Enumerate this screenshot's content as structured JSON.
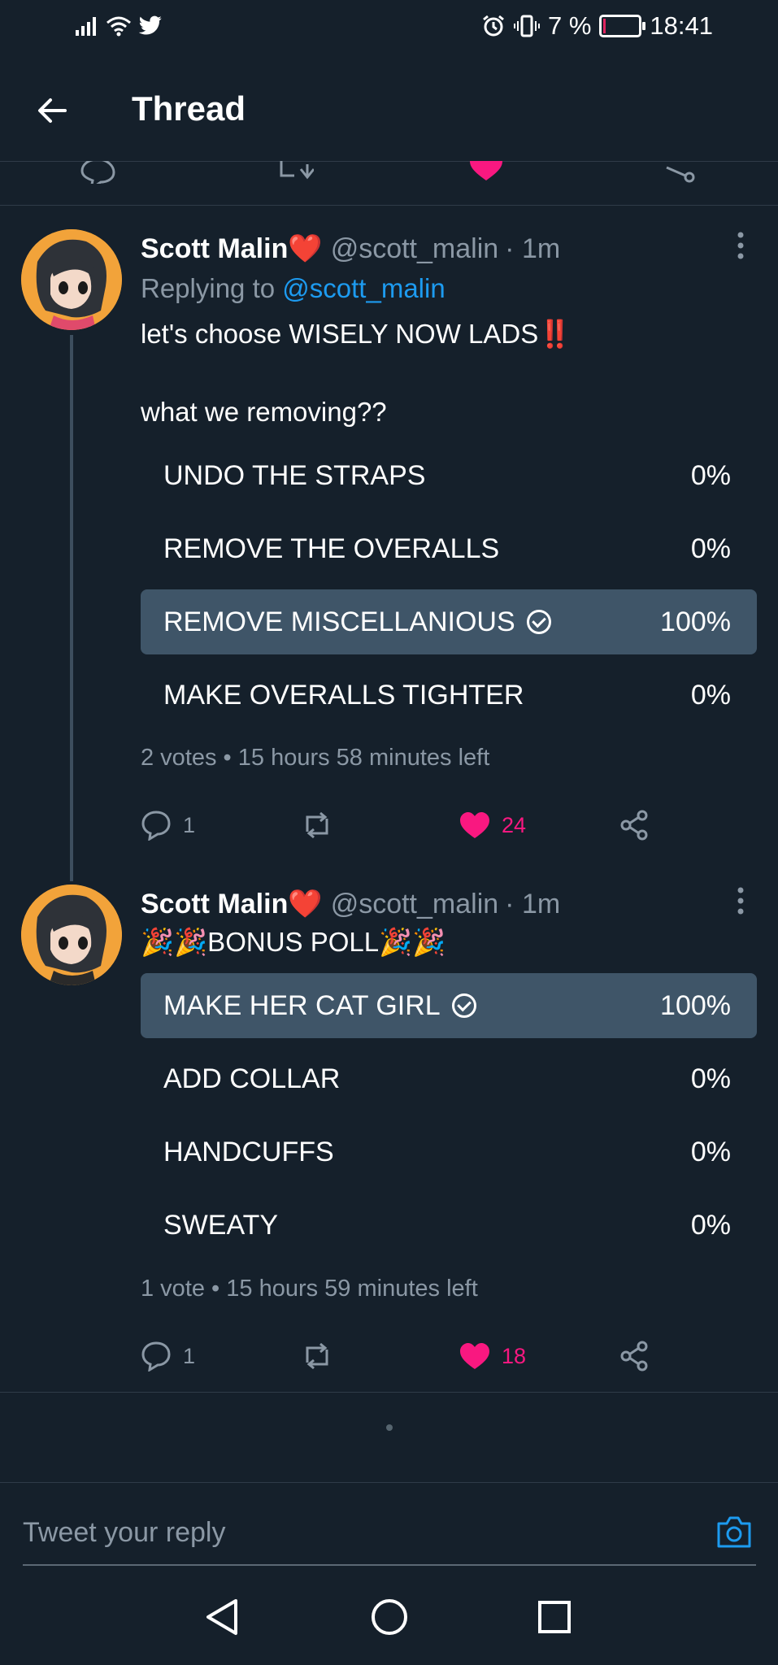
{
  "status_bar": {
    "left_icons": [
      "signal-icon",
      "wifi-icon",
      "twitter-bird-icon"
    ],
    "battery_level": "7 %",
    "battery_fraction": 0.07,
    "time": "18:41"
  },
  "header": {
    "title": "Thread"
  },
  "tweets": [
    {
      "name": "Scott Malin",
      "name_emoji": "❤️",
      "handle": "@scott_malin",
      "time": "· 1m",
      "replying_prefix": "Replying to",
      "replying_handle": "@scott_malin",
      "text_line1": "let's choose WISELY NOW LADS",
      "text_line1_emoji": "‼️",
      "text_line2": "what we removing??",
      "poll": [
        {
          "label": "UNDO THE STRAPS",
          "percent": "0%",
          "selected": false
        },
        {
          "label": "REMOVE THE OVERALLS",
          "percent": "0%",
          "selected": false
        },
        {
          "label": "REMOVE MISCELLANIOUS",
          "percent": "100%",
          "selected": true
        },
        {
          "label": "MAKE OVERALLS TIGHTER",
          "percent": "0%",
          "selected": false
        }
      ],
      "poll_meta": "2 votes • 15 hours 58 minutes left",
      "replies": "1",
      "likes": "24"
    },
    {
      "name": "Scott Malin",
      "name_emoji": "❤️",
      "handle": "@scott_malin",
      "time": "· 1m",
      "text_line1": "🎉🎉BONUS POLL🎉🎉",
      "poll": [
        {
          "label": "MAKE HER CAT GIRL",
          "percent": "100%",
          "selected": true
        },
        {
          "label": "ADD COLLAR",
          "percent": "0%",
          "selected": false
        },
        {
          "label": "HANDCUFFS",
          "percent": "0%",
          "selected": false
        },
        {
          "label": "SWEATY",
          "percent": "0%",
          "selected": false
        }
      ],
      "poll_meta": "1 vote • 15 hours 59 minutes left",
      "replies": "1",
      "likes": "18"
    }
  ],
  "reply_bar": {
    "placeholder": "Tweet your reply"
  },
  "colors": {
    "background": "#15202b",
    "accent": "#1d9bf0",
    "like": "#f91880",
    "poll_winner": "#3f5568",
    "muted": "#8b98a5"
  }
}
